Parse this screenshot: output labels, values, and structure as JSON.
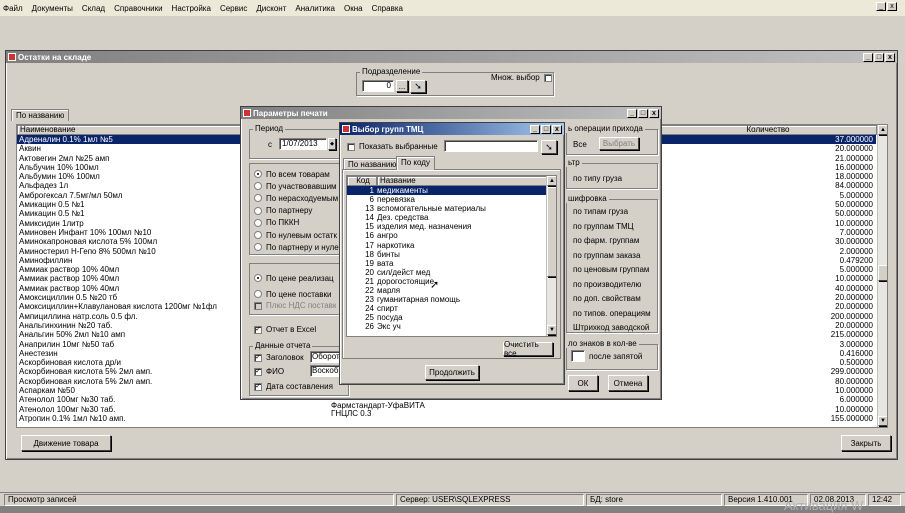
{
  "menu": [
    "Файл",
    "Документы",
    "Склад",
    "Справочники",
    "Настройка",
    "Сервис",
    "Дисконт",
    "Аналитика",
    "Окна",
    "Справка"
  ],
  "main_window": {
    "title": "Остатки на складе",
    "dept_label": "Подразделение",
    "dept_value": "0",
    "multi_label": "Множ. выбор",
    "tab": "По названию",
    "col_name": "Наименование",
    "col_qty": "Количество",
    "names": [
      "Адреналин 0.1% 1мл №5",
      "Аквин",
      "Актовегин 2мл №25 амп",
      "Альбучин 10% 100мл",
      "Альбумин 10% 100мл",
      "Альфадез 1л",
      "Амброгексал 7.5мг/мл 50мл",
      "Амикацин 0.5 №1",
      "Амикацин 0.5 №1",
      "Амикcидин 1литр",
      "Аминовен Инфант 10% 100мл №10",
      "Аминокапроновая кислота 5% 100мл",
      "Аминостерил Н-Гепо 8% 500мл №10",
      "Аминофиллин",
      "Аммиак раствор 10% 40мл",
      "Аммиак раствор 10% 40мл",
      "Аммиак раствор 10% 40мл",
      "Амоксициллин 0.5 №20 тб",
      "Амоксициллин+Клавулановая кислота 1200мг №1фл",
      "Ампициллина натр.соль 0.5 фл.",
      "Анальгинхинин №20 таб.",
      "Анальгин 50% 2мл №10 амп",
      "Анаприлин 10мг №50 таб",
      "Анестезин",
      "Аскорбиновая кислота др/и",
      "Аскорбиновая кислота 5% 2мл амп.",
      "Аскорбиновая кислота 5% 2мл амп.",
      "Аспаркам №50",
      "Атенолол 100мг №30 таб.",
      "Атенолол 100мг №30 таб.",
      "Атропин 0.1% 1мл №10 амп."
    ],
    "qtys": [
      "37.000000",
      "20.000000",
      "21.000000",
      "16.000000",
      "18.000000",
      "84.000000",
      "5.000000",
      "50.000000",
      "50.000000",
      "10.000000",
      "7.000000",
      "30.000000",
      "2.000000",
      "0.479200",
      "5.000000",
      "10.000000",
      "40.000000",
      "20.000000",
      "20.000000",
      "200.000000",
      "20.000000",
      "215.000000",
      "3.000000",
      "0.416000",
      "0.500000",
      "299.000000",
      "80.000000",
      "10.000000",
      "6.000000",
      "10.000000",
      "155.000000"
    ],
    "mfr_rows": [
      "Фармстандарт-УфаВИТА",
      "ГНЦЛС 0.3"
    ],
    "move_btn": "Движение товара",
    "close_btn": "Закрыть"
  },
  "print_dialog": {
    "title": "Параметры печати",
    "period_label": "Период",
    "from_label": "с",
    "date_from": "1/07/2013",
    "radios1": [
      "По всем товарам",
      "По участвовавшим",
      "По нерасходуемым",
      "По партнеру",
      "По ПККН",
      "По нулевым остатк",
      "По партнеру и нуле"
    ],
    "radios2": [
      "По цене реализац",
      "По цене поставки"
    ],
    "vat_label": "Плюс НДС поставк",
    "excel_label": "Отчет в Excel",
    "report_data_label": "Данные отчета",
    "header_label": "Заголовок",
    "header_value": "Оборот",
    "fio_label": "ФИО",
    "fio_value": "Воскоб",
    "date_label": "Дата составления",
    "ops_group": "ь операции прихода",
    "all_label": "Все",
    "choose_btn": "Выбрать",
    "filter_group": "ьтр",
    "filter_item": "по типу груза",
    "grouping_group": "шифровка",
    "grouping": [
      "по типам груза",
      "по группам ТМЦ",
      "по фарм. группам",
      "по группам заказа",
      "по ценовым группам",
      "по производителю",
      "по доп. свойствам",
      "по типов. операциям",
      "Штрихкод заводской"
    ],
    "signs_group": "ло знаков в кол-ве",
    "after_comma": "после запятой",
    "ok_btn": "ОК",
    "cancel_btn": "Отмена"
  },
  "group_dialog": {
    "title": "Выбор групп ТМЦ",
    "show_selected": "Показать выбранные",
    "tab_name": "По названию",
    "tab_code": "По коду",
    "col_code": "Код",
    "col_name": "Название",
    "rows": [
      {
        "code": "1",
        "name": "медикаменты"
      },
      {
        "code": "6",
        "name": "перевязка"
      },
      {
        "code": "13",
        "name": "вспомогательные материалы"
      },
      {
        "code": "14",
        "name": "Дез. средства"
      },
      {
        "code": "15",
        "name": "изделия мед. назначения"
      },
      {
        "code": "16",
        "name": "ангро"
      },
      {
        "code": "17",
        "name": "наркотика"
      },
      {
        "code": "18",
        "name": "бинты"
      },
      {
        "code": "19",
        "name": "вата"
      },
      {
        "code": "20",
        "name": "сил/дейст мед"
      },
      {
        "code": "21",
        "name": "дорогостоящие"
      },
      {
        "code": "22",
        "name": "марля"
      },
      {
        "code": "23",
        "name": "гуманитарная помощь"
      },
      {
        "code": "24",
        "name": "спирт"
      },
      {
        "code": "25",
        "name": "посуда"
      },
      {
        "code": "26",
        "name": "Экс уч"
      }
    ],
    "clear_btn": "Очистить все",
    "continue_btn": "Продолжить"
  },
  "status": {
    "left": "Просмотр записей",
    "server": "Сервер: USER\\SQLEXPRESS",
    "db": "БД: store",
    "version": "Версия 1.410.001",
    "date": "02.08.2013",
    "time": "12:42"
  },
  "watermark": "Активация W"
}
